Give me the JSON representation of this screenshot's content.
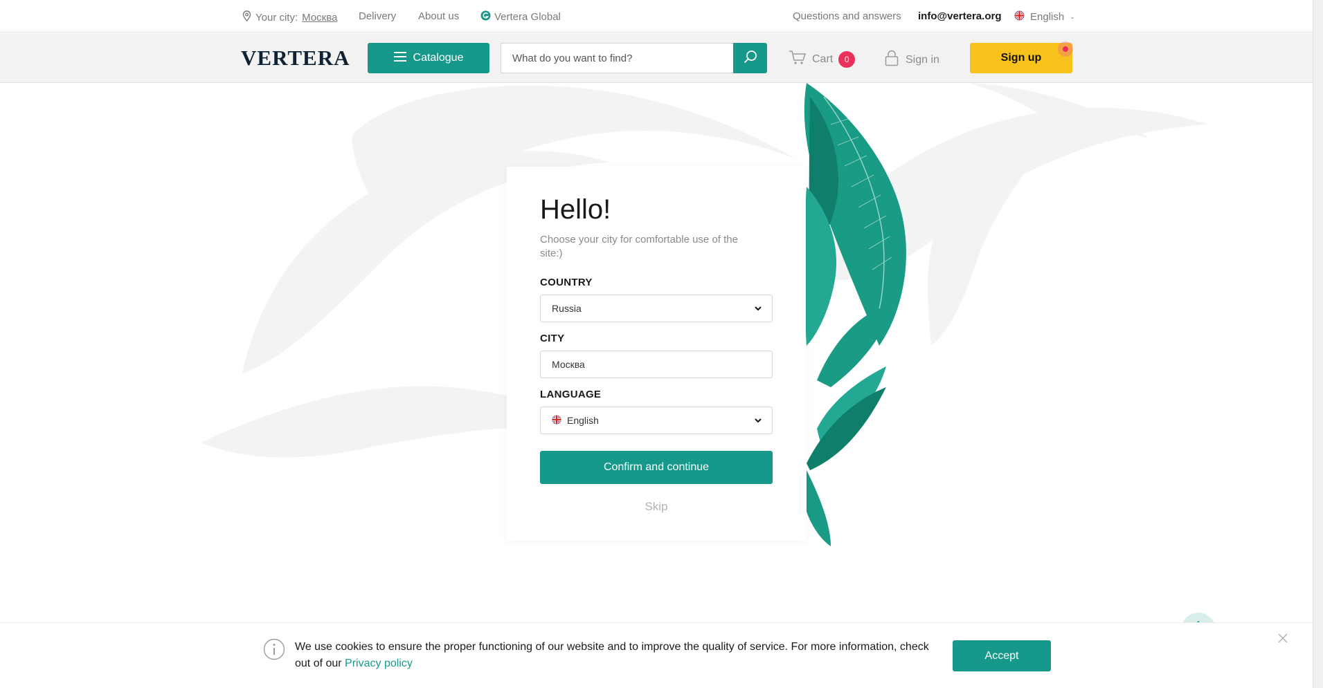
{
  "topbar": {
    "city_prefix": "Your city:",
    "city": "Москва",
    "delivery": "Delivery",
    "about": "About us",
    "global": "Vertera Global",
    "faq": "Questions and answers",
    "email": "info@vertera.org",
    "language": "English"
  },
  "header": {
    "logo": "VERTERA",
    "catalogue": "Catalogue",
    "search_placeholder": "What do you want to find?",
    "cart_label": "Cart",
    "cart_count": "0",
    "signin": "Sign in",
    "signup": "Sign up"
  },
  "modal": {
    "title": "Hello!",
    "subtitle": "Choose your city for comfortable use of the site:)",
    "country_label": "COUNTRY",
    "country_value": "Russia",
    "city_label": "CITY",
    "city_value": "Москва",
    "language_label": "LANGUAGE",
    "language_value": "English",
    "confirm": "Confirm and continue",
    "skip": "Skip"
  },
  "cookie": {
    "text": "We use cookies to ensure the proper functioning of our website and to improve the quality of service. For more information, check out of our ",
    "link": "Privacy policy",
    "accept": "Accept"
  },
  "colors": {
    "accent": "#16998a",
    "signup": "#f7c21b",
    "badge": "#e8305a"
  },
  "icons": [
    "location-pin-icon",
    "globe-icon",
    "flag-uk-icon",
    "menu-icon",
    "search-icon",
    "cart-icon",
    "lock-icon",
    "chevron-down-icon",
    "arrow-up-icon",
    "info-icon",
    "close-icon"
  ]
}
